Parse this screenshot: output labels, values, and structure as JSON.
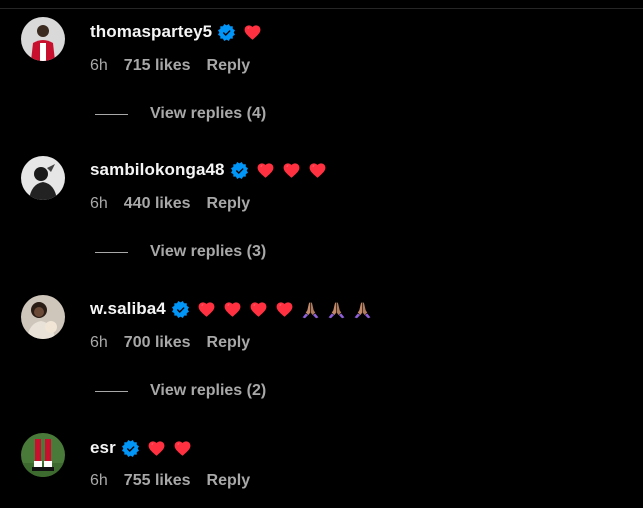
{
  "colors": {
    "background": "#000000",
    "text_primary": "#f5f5f5",
    "text_secondary": "#a8a8a8",
    "verified": "#0095f6",
    "heart": "#ff3040"
  },
  "comments": [
    {
      "username": "thomaspartey5",
      "verified": true,
      "text": "❤️",
      "emojis": [
        "red-heart"
      ],
      "time": "6h",
      "likes": "715 likes",
      "reply_label": "Reply",
      "view_replies": "View replies (4)"
    },
    {
      "username": "sambilokonga48",
      "verified": true,
      "text": "❤️❤️❤️",
      "emojis": [
        "red-heart",
        "red-heart",
        "red-heart"
      ],
      "time": "6h",
      "likes": "440 likes",
      "reply_label": "Reply",
      "view_replies": "View replies (3)"
    },
    {
      "username": "w.saliba4",
      "verified": true,
      "text": "❤️❤️❤️❤️🙏🏽🙏🏽🙏🏽",
      "emojis": [
        "red-heart",
        "red-heart",
        "red-heart",
        "red-heart",
        "folded-hands",
        "folded-hands",
        "folded-hands"
      ],
      "time": "6h",
      "likes": "700 likes",
      "reply_label": "Reply",
      "view_replies": "View replies (2)"
    },
    {
      "username": "esr",
      "verified": true,
      "text": "❤️❤️",
      "emojis": [
        "red-heart",
        "red-heart"
      ],
      "time": "6h",
      "likes": "755 likes",
      "reply_label": "Reply"
    }
  ]
}
